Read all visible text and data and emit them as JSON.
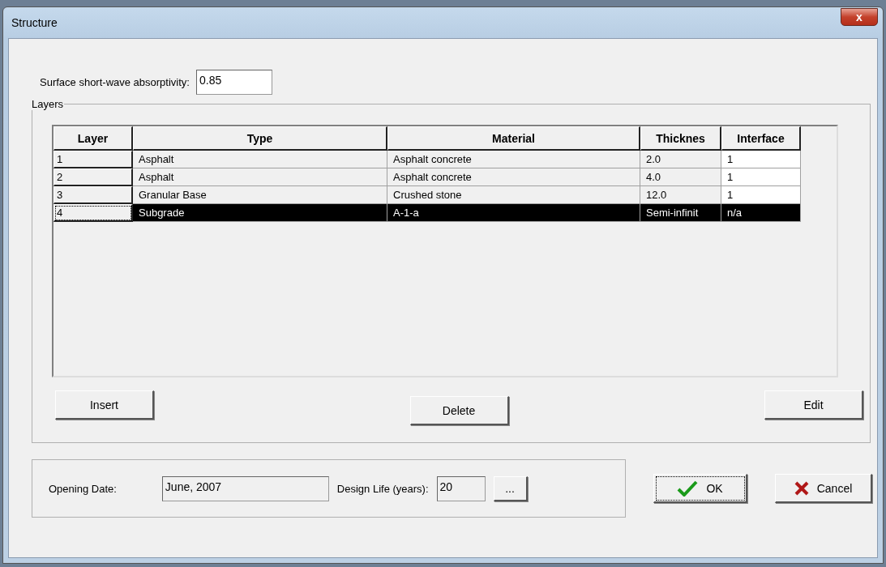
{
  "window": {
    "title": "Structure",
    "close": "x"
  },
  "absorptivity": {
    "label": "Surface short-wave absorptivity:",
    "value": "0.85"
  },
  "layers": {
    "title": "Layers",
    "columns": [
      "Layer",
      "Type",
      "Material",
      "Thicknes",
      "Interface"
    ],
    "rows": [
      {
        "cells": [
          "1",
          "Asphalt",
          "Asphalt concrete",
          "2.0",
          "1"
        ],
        "selected": false
      },
      {
        "cells": [
          "2",
          "Asphalt",
          "Asphalt concrete",
          "4.0",
          "1"
        ],
        "selected": false
      },
      {
        "cells": [
          "3",
          "Granular Base",
          "Crushed stone",
          "12.0",
          "1"
        ],
        "selected": false
      },
      {
        "cells": [
          "4",
          "Subgrade",
          "A-1-a",
          "Semi-infinit",
          "n/a"
        ],
        "selected": true
      }
    ],
    "buttons": [
      "Insert",
      "Delete",
      "Edit"
    ]
  },
  "dates": {
    "opening_label": "Opening Date:",
    "opening_value": "June, 2007",
    "life_label": "Design Life (years):",
    "life_value": "20",
    "more_button": "..."
  },
  "ok_button": "OK",
  "cancel_button": "Cancel"
}
